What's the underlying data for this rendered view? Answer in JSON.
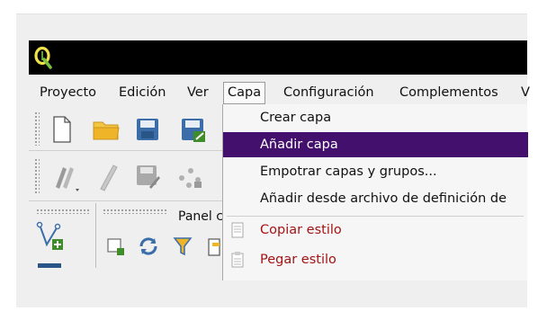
{
  "menubar": {
    "items": [
      {
        "label": "Proyecto"
      },
      {
        "label": "Edición"
      },
      {
        "label": "Ver"
      },
      {
        "label": "Capa"
      },
      {
        "label": "Configuración"
      },
      {
        "label": "Complementos"
      },
      {
        "label": "V"
      }
    ]
  },
  "capa_menu": {
    "items": [
      {
        "label": "Crear capa"
      },
      {
        "label": "Añadir capa"
      },
      {
        "label": "Empotrar capas y grupos..."
      },
      {
        "label": "Añadir desde archivo de definición de"
      },
      {
        "label": "Copiar estilo"
      },
      {
        "label": "Pegar estilo"
      }
    ]
  },
  "panel": {
    "label": "Panel c"
  },
  "colors": {
    "highlight": "#43106e",
    "menu_red_text": "#a31414",
    "titlebar": "#000000",
    "folder": "#f0b429",
    "save_blue": "#3b6ea8",
    "qgis_green": "#7ac143"
  },
  "icons": [
    "qgis-logo-icon",
    "new-project-icon",
    "open-folder-icon",
    "save-icon",
    "save-as-icon",
    "digitize-icon",
    "pencil-icon",
    "edit-save-icon",
    "vertices-icon",
    "add-layer-icon",
    "select-icon",
    "refresh-icon",
    "filter-icon",
    "copy-style-icon",
    "paste-style-icon"
  ]
}
